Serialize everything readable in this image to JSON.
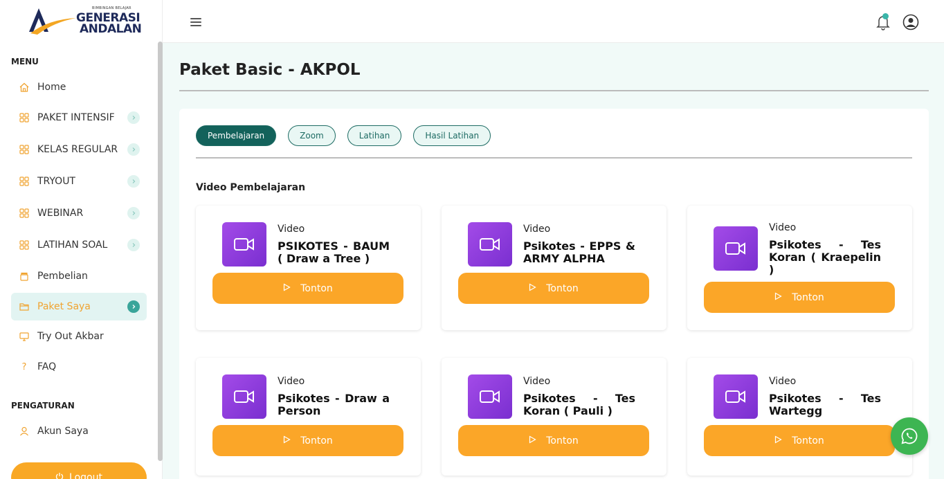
{
  "logo": {
    "tagline": "BIMBINGAN BELAJAR",
    "line1": "GENERASI",
    "line2": "ANDALAN"
  },
  "sidebar": {
    "menu_label": "MENU",
    "settings_label": "PENGATURAN",
    "items": [
      {
        "label": "Home",
        "icon": "home-icon"
      },
      {
        "label": "PAKET INTENSIF",
        "icon": "grid-icon"
      },
      {
        "label": "KELAS REGULAR",
        "icon": "grid-icon"
      },
      {
        "label": "TRYOUT",
        "icon": "grid-icon"
      },
      {
        "label": "WEBINAR",
        "icon": "grid-icon"
      },
      {
        "label": "LATIHAN SOAL",
        "icon": "grid-icon"
      },
      {
        "label": "Pembelian",
        "icon": "box-icon"
      },
      {
        "label": "Paket Saya",
        "icon": "folder-icon"
      },
      {
        "label": "Try Out Akbar",
        "icon": "monitor-icon"
      },
      {
        "label": "FAQ",
        "icon": "question-icon"
      }
    ],
    "settings_items": [
      {
        "label": "Akun Saya",
        "icon": "user-icon"
      }
    ],
    "logout_label": "Logout"
  },
  "main": {
    "title": "Paket Basic - AKPOL",
    "tabs": [
      "Pembelajaran",
      "Zoom",
      "Latihan",
      "Hasil Latihan"
    ],
    "section_title": "Video Pembelajaran",
    "videos": [
      {
        "type": "Video",
        "title": "PSIKOTES - BAUM ( Draw a Tree )",
        "button": "Tonton"
      },
      {
        "type": "Video",
        "title": "Psikotes - EPPS & ARMY ALPHA",
        "button": "Tonton"
      },
      {
        "type": "Video",
        "title": "Psikotes - Tes Koran ( Kraepelin )",
        "button": "Tonton"
      },
      {
        "type": "Video",
        "title": "Psikotes - Draw a Person",
        "button": "Tonton"
      },
      {
        "type": "Video",
        "title": "Psikotes - Tes Koran ( Pauli )",
        "button": "Tonton"
      },
      {
        "type": "Video",
        "title": "Psikotes - Tes Wartegg",
        "button": "Tonton"
      }
    ]
  },
  "colors": {
    "accent": "#fba628",
    "teal": "#13625b",
    "purple": "#8a3ad8",
    "whatsapp": "#3db552"
  }
}
